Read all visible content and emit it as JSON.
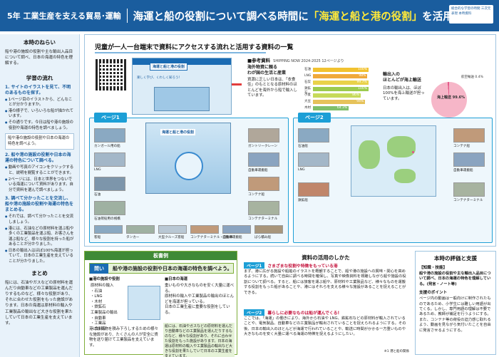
{
  "header": {
    "grade": "5年  工業生産を支える貿易･運輸",
    "title_pre": "海運と船の役割について調べる時間に",
    "title_highlight": "「海運と船と港の役割」",
    "title_post": "を活用する。",
    "tag": "総合的な学習の時間 三次元表現 本時資料"
  },
  "left": {
    "aim_title": "本時のねらい",
    "aim_text": "船や港の施設の役割や主な輸出入品目について調べ、日本の海運の特色を理解する。",
    "flow_title": "学習の流れ",
    "step1": "1. サイトのイラストを見て、不明のあるものを探す。",
    "step1_items": [
      "1ページ目のイラストから、どんなことが分かりますか。",
      "港の様子で、いろいろな船が描かれています。",
      "その通りです。今日は船や港の施設の役割や海運の特色を調べましょう。"
    ],
    "box1": "船や港の施設の役割や日本の海運の特色を調べよう。",
    "step2": "2. 船や港の施設の役割や日本の海運の特色について調べる。",
    "step2_items": [
      "動画や写真のアイコンをクリックすると、説明を閲覧することができます。",
      "2ページには、日本と世界をつないでいる海運について資料があります。自分で資料を選んで調べましょう。"
    ],
    "step3": "3. 調べて分かったことを交流し、船や港の施設の役割や海運の特色をまとめる。",
    "step3_items": [
      "それでは、調べて分かったことを交流しましょう。",
      "港には、石油などの原材料を運ぶ船や多くの工業製品を運ぶ船、お客さんを運ぶ船など、様々な役割を持った船があることが分かりました。",
      "日本の輸出入はほぼ100%海運が担っていて、日本の工業生産を支えていることが分かりました。"
    ],
    "summary_title": "まとめ",
    "summary_text": "船には、石油やガスなどの原材料を運んだり自動車などの工業製品を運んだりするものなど、様々な役割があり、それに合わせた役割をもった施設があります。日本の海運は原材料の輸入や工業製品の輸出など大きな役割を果たしていて日本の工業生産を支えています。"
  },
  "main": {
    "title": "児童が一人一台端末で資料にアクセスする流れと活用する資料の一覧",
    "site_title": "海運と船と港の役割",
    "site_subtitle": "楽しく学び、くわしく知ろう！",
    "ref_title": "参考資料",
    "ref_source": "SHIPPING NOW 2024-2025 12ページより",
    "ref_left_label": "海外物資に頼る\nわが国の生活と産業",
    "ref_left_text": "資源に乏しい日本は、「衣食住」のもととなる原材料のほとんどを海外から船で輸入しています。",
    "ref_left_caption": "主な資源の対外依存度",
    "ref_right_label": "輸出入の\nほとんどが海上輸送",
    "ref_right_text": "日本の輸出入は、ほぼ100%を海上輸送が担っています。",
    "ref_right_caption": "日本の貿易量における海上輸送の割合",
    "pie_label": "海上輸送 99.6%",
    "pie_air": "航空輸送 0.4%",
    "bars": [
      {
        "label": "石油",
        "value": 100,
        "text": "100%"
      },
      {
        "label": "LNG",
        "value": 98,
        "text": "98%"
      },
      {
        "label": "石炭",
        "value": 99.7,
        "text": "99.7%"
      },
      {
        "label": "鉄鉱石",
        "value": 100,
        "text": "100%"
      },
      {
        "label": "小麦",
        "value": 86,
        "text": "86%"
      },
      {
        "label": "大豆",
        "value": 94,
        "text": "94%"
      },
      {
        "label": "木材",
        "value": 64.3,
        "text": "64.3%"
      }
    ],
    "page1_title": "ページ1",
    "page2_title": "ページ2",
    "page1_labels": [
      "カンガール用の船",
      "LNG",
      "石油",
      "石油荷役用の桟橋",
      "ガントリークレーン",
      "自動車運搬船",
      "コンテナ船",
      "コンテナターミナル",
      "石油荷役用桟橋、陸側の桟橋",
      "貨客船",
      "大型クルーズ客船",
      "コンテナ船・自動車",
      "自動車運搬船"
    ],
    "page1_bottom": [
      "客船",
      "タンカー",
      "大型クルーズ客船",
      "コンテナターミナル・自動車",
      "自動車運搬船",
      "ばら積み船"
    ],
    "page2_labels": [
      "石油船",
      "LNG",
      "コンテナ船",
      "自動車運搬船",
      "コンテナターミナル",
      "鉄鉱船"
    ]
  },
  "board": {
    "header": "板書例",
    "q_badge": "問い",
    "question": "船や港の施設の役割や日本の海運の特色を調べよう。",
    "col1_title": "■港の施設や役割",
    "col1_items": [
      "原材料の輸入",
      "・石油",
      "・LNG",
      "・木材",
      "・鉄鉱石",
      "工業製品の輸出",
      "・自動車",
      "・工業品",
      "・食料品"
    ],
    "col2_title": "■日本の海運",
    "col2_items": [
      "重いものや大きなものを安く大量に運べる。",
      "原材料の輸入や工業製品の輸出のほとんどを海運が担っている。",
      "日本の工業生産に重要な役割をしている。"
    ],
    "bottom": "港には貨物を積み下ろしするための様々な施設があり、たくさんの人が安全に貨物を送り届けて工業製品を支えています。",
    "right_note": "船には、石油やガスなどの原材料を運んだり自動車などの工業製品を運んだりするものなど、様々な役割があり、それに合わせた役割をもった施設があります。日本の海運は原材料の輸入や工業製品の輸出など大きな役割を果たしていて日本の工業生産を支えています。"
  },
  "usage": {
    "title": "資料の活用のしかた",
    "tag1": "ページ1",
    "tag1_text": "さまざまな役割や特徴をもっている港",
    "text1": "まず、港に広がる施設や船舶のイラストを概観することで、船や港の施設への興味・関心を高めるようにする。続いて自由に調べる時間を確保し、写真や映像資料を視聴しながら船や施設の役割について調べる。すると、船には旅客を運ぶ船や、原材料や工業製品など、様々なものを運搬する役割をもった船があることや、港にはそれらを支える様々な施設があることを捉えることができる。",
    "tag2": "ページ2",
    "tag2_text": "暮らしに必要なものは船が運んでくる!",
    "text2": "ここでは、「海運」の働きにより、海外から石油や LNG、鉄鉱石などの原材料が輸入されていることや、電気製品、自動車などの工業製品が輸出されていることを捉えられるようにする。その後、日本の輸出入のほとんどが海運で行われていることや、輸送に時間がかかる一方重いものや大きなものを安く大量に運べる海運の特徴を捉えるようにしたい。",
    "credit": "※1 港と船の関係"
  },
  "evaluation": {
    "title": "本時の評価と支援",
    "tag": "【知識・技能】",
    "criterion": "船や港の施設の役割や主な輸出入品目について調べ、日本の海運の特色を理解している。(発言・ノート等)",
    "support_title": "支援のポイント",
    "support_text": "ページ内の動画は一般向けに制作されたものであるため、小学生には難しい用語が出てくる。しかし、専門用語の理解は不要であるため、教師が補足を行うようにする。また、コンテナ等の荷役の迫力感じ取れるよう、動画を見ながら気付いたことを自由に発言させるようにする。"
  }
}
